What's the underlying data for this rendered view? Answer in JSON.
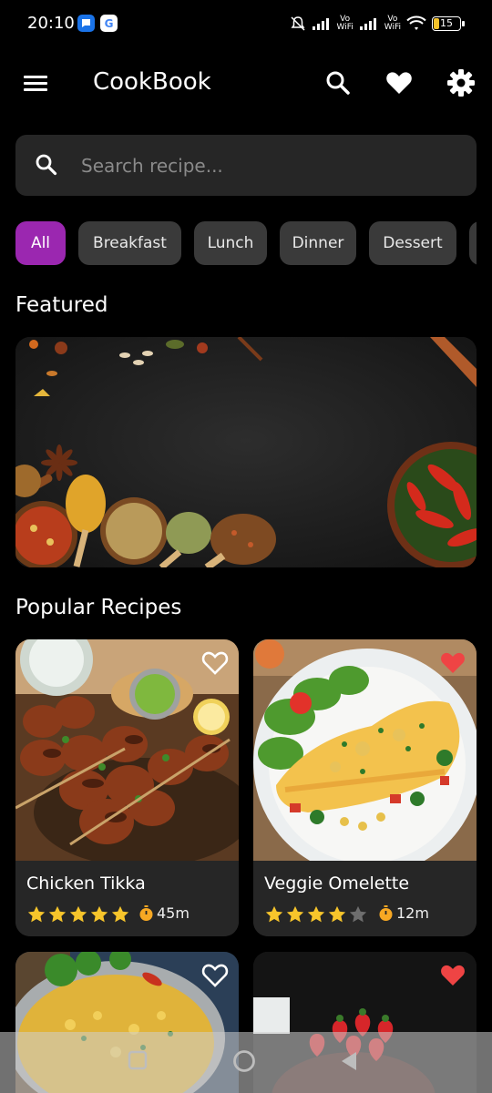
{
  "status": {
    "time": "20:10",
    "network_label_1": "Vo\nWiFi",
    "network_label_2": "Vo\nWiFi",
    "battery": "15"
  },
  "app_bar": {
    "title": "CookBook",
    "icons": [
      "menu-icon",
      "search-icon",
      "heart-icon",
      "gear-icon"
    ]
  },
  "search": {
    "placeholder": "Search recipe..."
  },
  "categories": [
    {
      "label": "All",
      "active": true
    },
    {
      "label": "Breakfast",
      "active": false
    },
    {
      "label": "Lunch",
      "active": false
    },
    {
      "label": "Dinner",
      "active": false
    },
    {
      "label": "Dessert",
      "active": false
    }
  ],
  "sections": {
    "featured_title": "Featured",
    "popular_title": "Popular Recipes"
  },
  "recipes": [
    {
      "name": "Chicken Tikka",
      "rating": 5,
      "time": "45m",
      "favorite": false
    },
    {
      "name": "Veggie Omelette",
      "rating": 4,
      "time": "12m",
      "favorite": true
    },
    {
      "name": "",
      "rating": 0,
      "time": "",
      "favorite": false
    },
    {
      "name": "",
      "rating": 0,
      "time": "",
      "favorite": true
    }
  ],
  "colors": {
    "accent": "#9b27b0",
    "chip": "#3a3a3a",
    "card": "#262626",
    "star": "#f7c52b",
    "favorite": "#ef4444"
  }
}
